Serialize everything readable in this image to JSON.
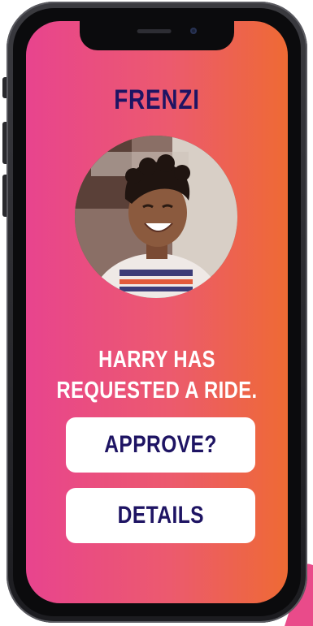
{
  "app": {
    "brand": "FRENZI"
  },
  "request": {
    "line1": "HARRY HAS",
    "line2": "REQUESTED A RIDE."
  },
  "actions": {
    "approve_label": "APPROVE?",
    "details_label": "DETAILS"
  },
  "colors": {
    "gradient_left": "#e8448e",
    "gradient_right": "#ee6a34",
    "brand_text": "#1e1463",
    "button_bg": "#ffffff"
  }
}
